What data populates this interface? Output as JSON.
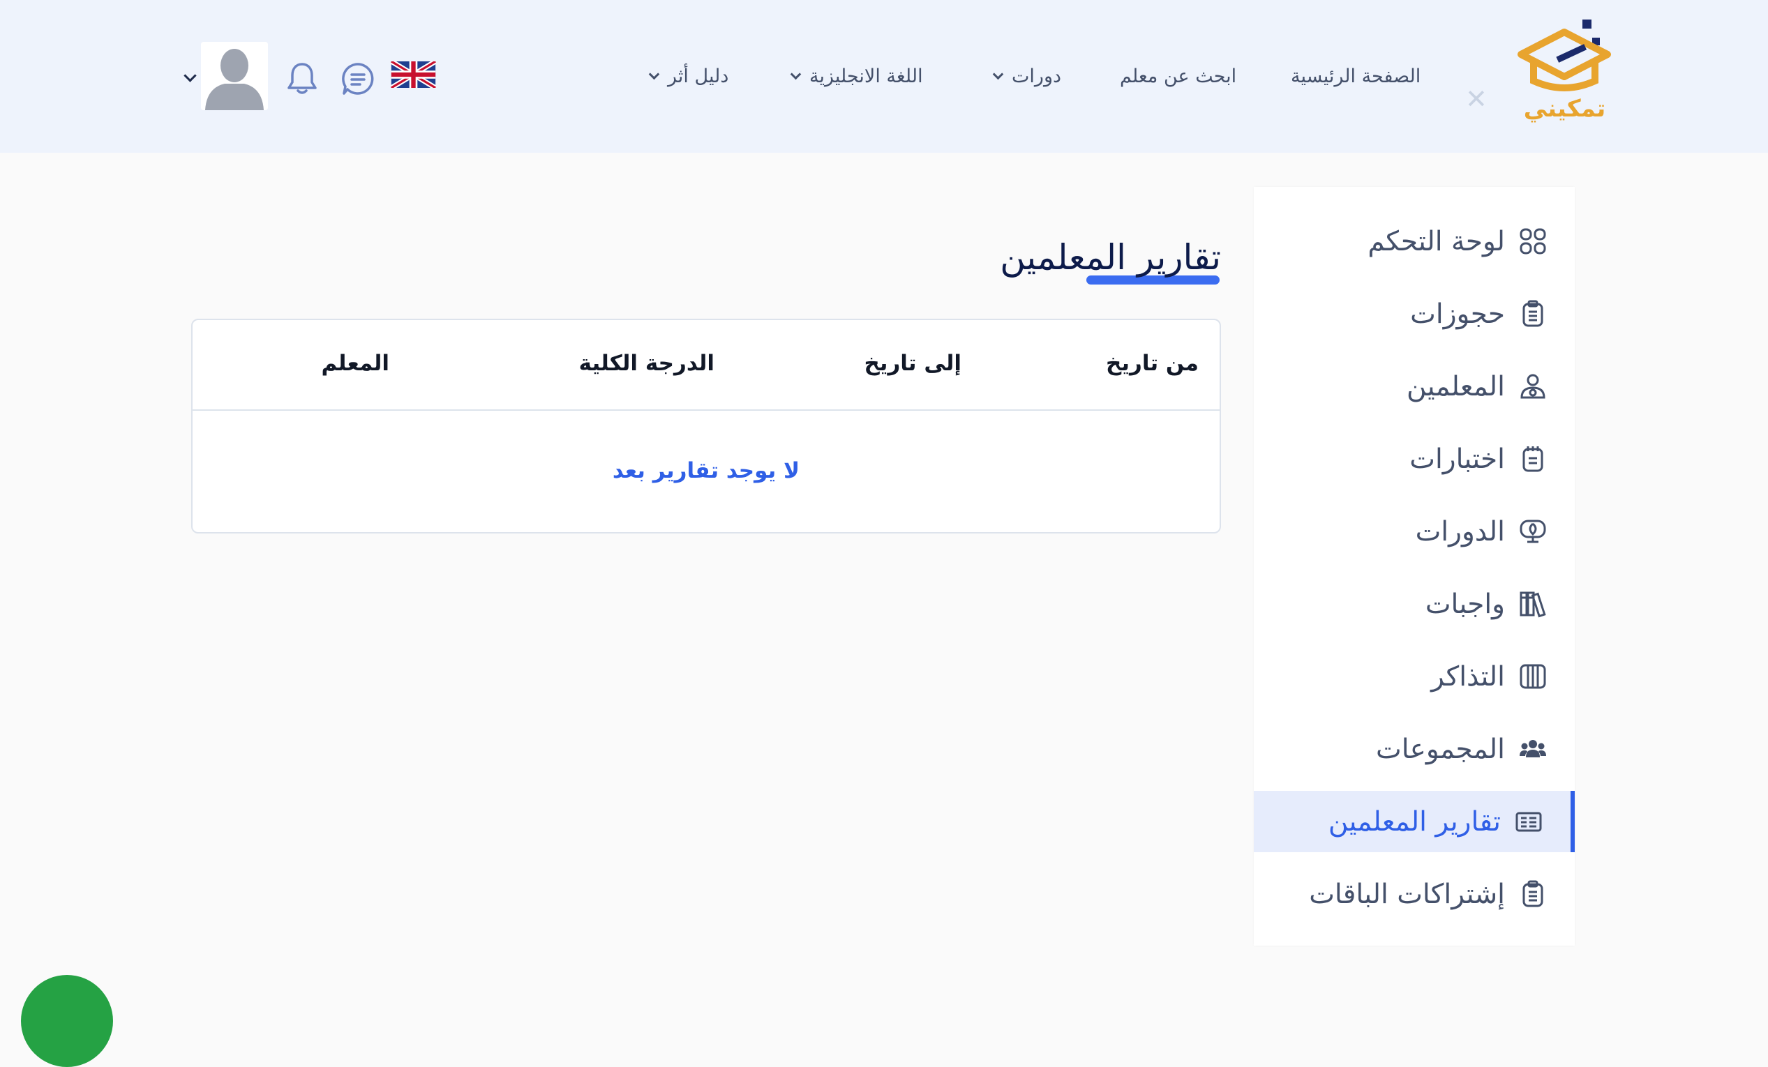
{
  "header": {
    "logo_text": "تمكيني",
    "nav": {
      "home": "الصفحة الرئيسية",
      "find_teacher": "ابحث عن معلم",
      "courses": "دورات",
      "english": "اللغة الانجليزية",
      "guide": "دليل أثر"
    },
    "icons": {
      "flag": "uk-flag-icon",
      "chat": "chat-icon",
      "bell": "bell-icon",
      "avatar": "user-avatar",
      "close": "close-icon"
    }
  },
  "sidebar": {
    "items": [
      {
        "label": "لوحة التحكم",
        "icon": "grid-icon"
      },
      {
        "label": "حجوزات",
        "icon": "clipboard-icon"
      },
      {
        "label": "المعلمين",
        "icon": "teacher-icon"
      },
      {
        "label": "اختبارات",
        "icon": "notepad-icon"
      },
      {
        "label": "الدورات",
        "icon": "monitor-icon"
      },
      {
        "label": "واجبات",
        "icon": "books-icon"
      },
      {
        "label": "التذاكر",
        "icon": "ticket-book-icon"
      },
      {
        "label": "المجموعات",
        "icon": "users-icon"
      },
      {
        "label": "تقارير المعلمين",
        "icon": "report-icon",
        "active": true
      },
      {
        "label": "إشتراكات الباقات",
        "icon": "clipboard-icon"
      }
    ]
  },
  "main": {
    "title": "تقارير المعلمين",
    "table": {
      "headers": {
        "from_date": "من تاريخ",
        "to_date": "إلى تاريخ",
        "total_grade": "الدرجة الكلية",
        "teacher": "المعلم"
      },
      "empty_message": "لا يوجد تقارير بعد"
    }
  },
  "colors": {
    "accent": "#2f5fe6",
    "header_bg": "#eef3fc",
    "logo_gold": "#e8a42e",
    "logo_navy": "#1b2a6b",
    "whatsapp": "#25a244"
  }
}
